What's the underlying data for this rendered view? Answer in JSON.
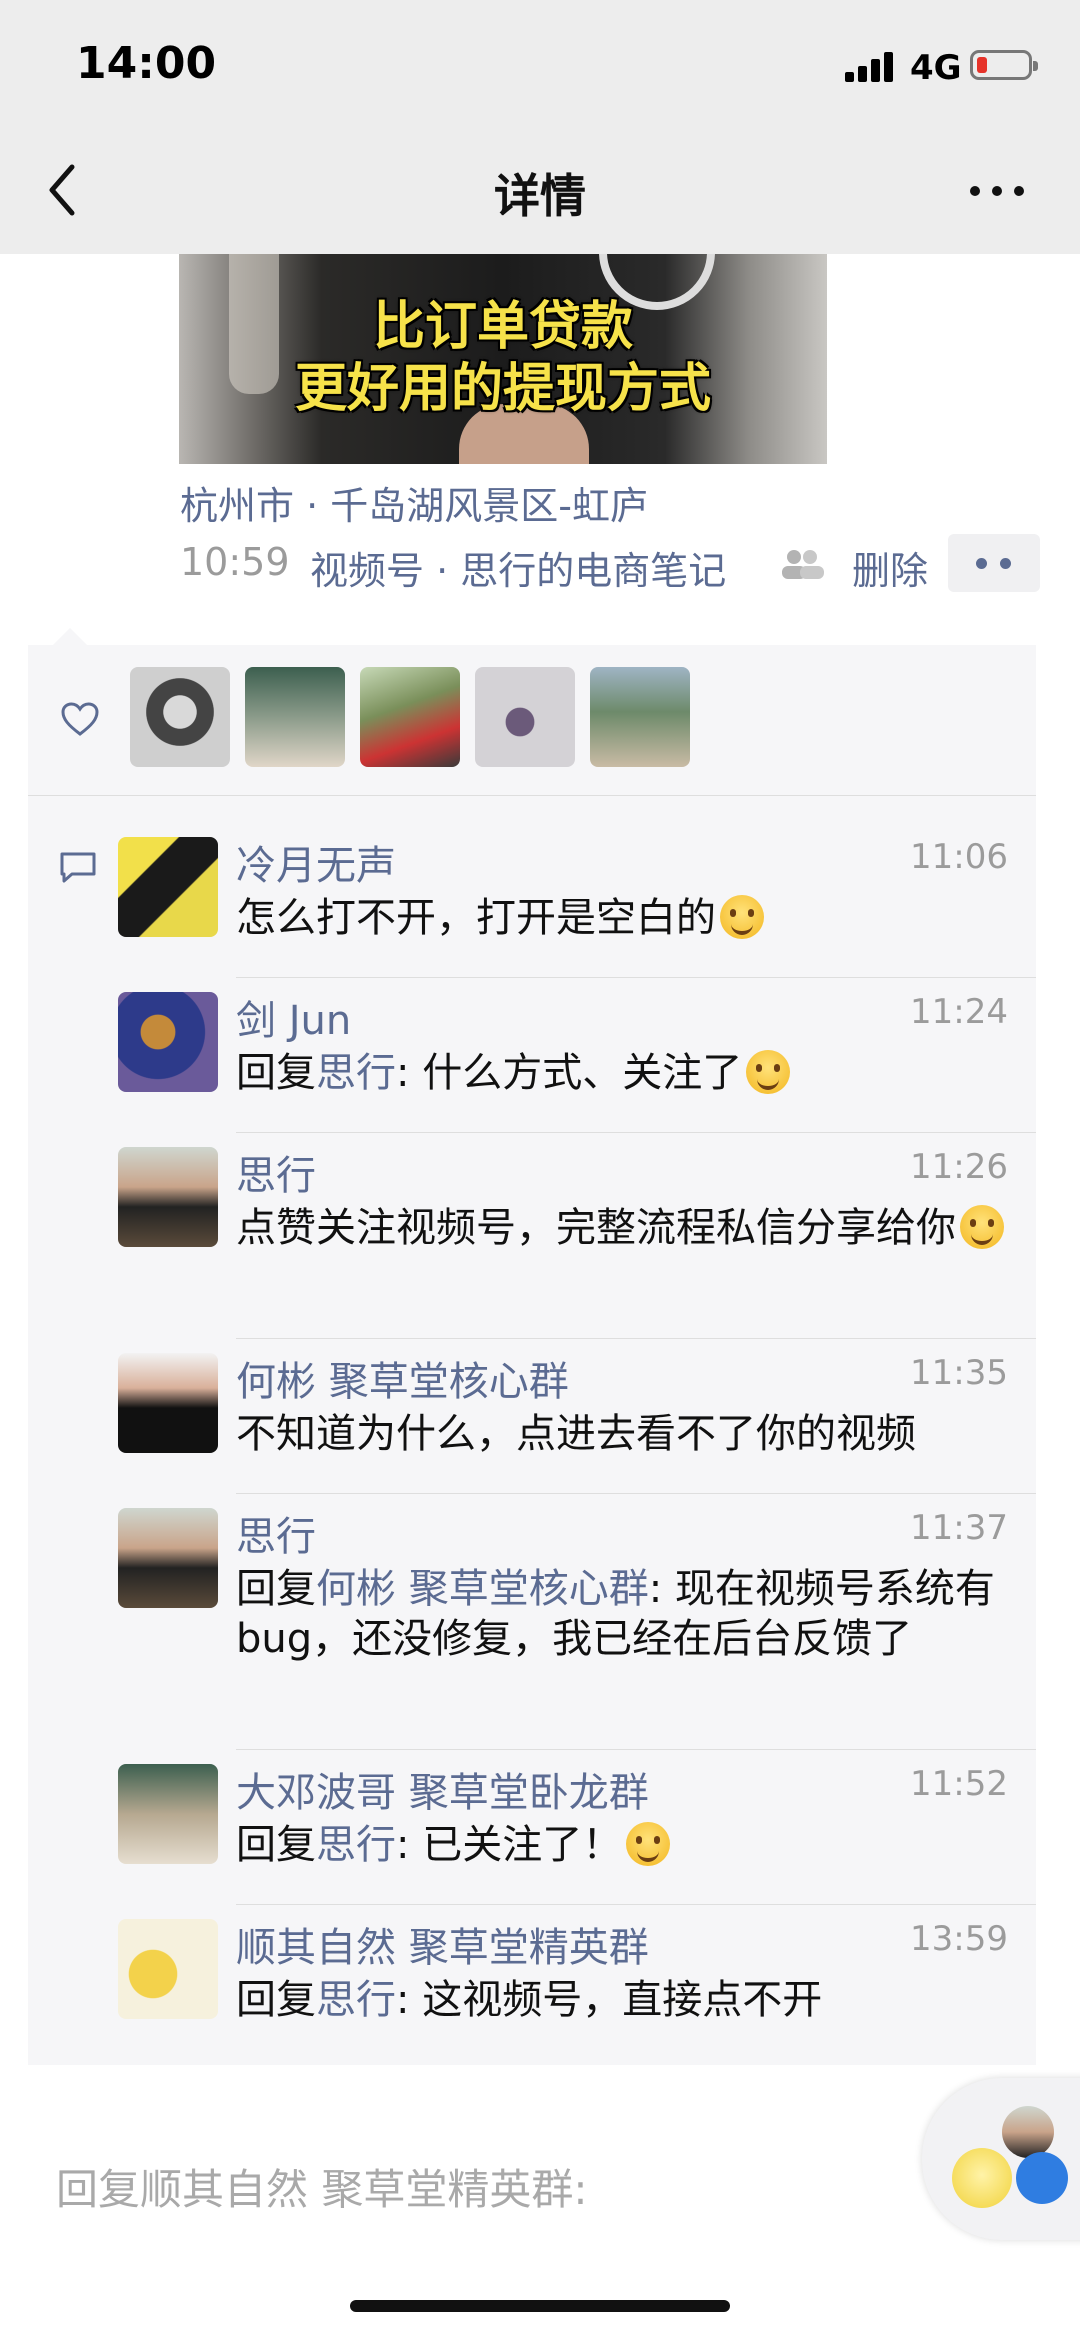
{
  "status_bar": {
    "time": "14:00",
    "network": "4G"
  },
  "nav": {
    "title": "详情"
  },
  "video": {
    "caption_line1": "比订单贷款",
    "caption_line2": "更好用的提现方式"
  },
  "post": {
    "location": "杭州市 · 千岛湖风景区-虹庐",
    "time": "10:59",
    "source": "视频号 · 思行的电商笔记",
    "delete_label": "删除"
  },
  "likes": {
    "count_shown": 5
  },
  "comments": [
    {
      "name": "冷月无声",
      "time": "11:06",
      "text": "怎么打不开，打开是空白的",
      "emoji": "crying-laughing-emoji"
    },
    {
      "name": "剑 Jun",
      "time": "11:24",
      "reply_prefix": "回复",
      "reply_to": "思行",
      "text": ": 什么方式、关注了",
      "emoji": "smile-emoji"
    },
    {
      "name": "思行",
      "time": "11:26",
      "text": "点赞关注视频号，完整流程私信分享给你",
      "emoji": "grin-emoji"
    },
    {
      "name": "何彬 聚草堂核心群",
      "time": "11:35",
      "text": "不知道为什么，点进去看不了你的视频"
    },
    {
      "name": "思行",
      "time": "11:37",
      "reply_prefix": "回复",
      "reply_to": "何彬 聚草堂核心群",
      "text": ": 现在视频号系统有 bug，还没修复，我已经在后台反馈了"
    },
    {
      "name": "大邓波哥 聚草堂卧龙群",
      "time": "11:52",
      "reply_prefix": "回复",
      "reply_to": "思行",
      "text": ": 已关注了！",
      "emoji": "smile-emoji"
    },
    {
      "name": "顺其自然 聚草堂精英群",
      "time": "13:59",
      "reply_prefix": "回复",
      "reply_to": "思行",
      "text": ": 这视频号，直接点不开"
    }
  ],
  "input": {
    "placeholder": "回复顺其自然 聚草堂精英群:"
  },
  "colors": {
    "link": "#5b6b92",
    "panel": "#f6f6f8",
    "bar": "#ededed"
  }
}
